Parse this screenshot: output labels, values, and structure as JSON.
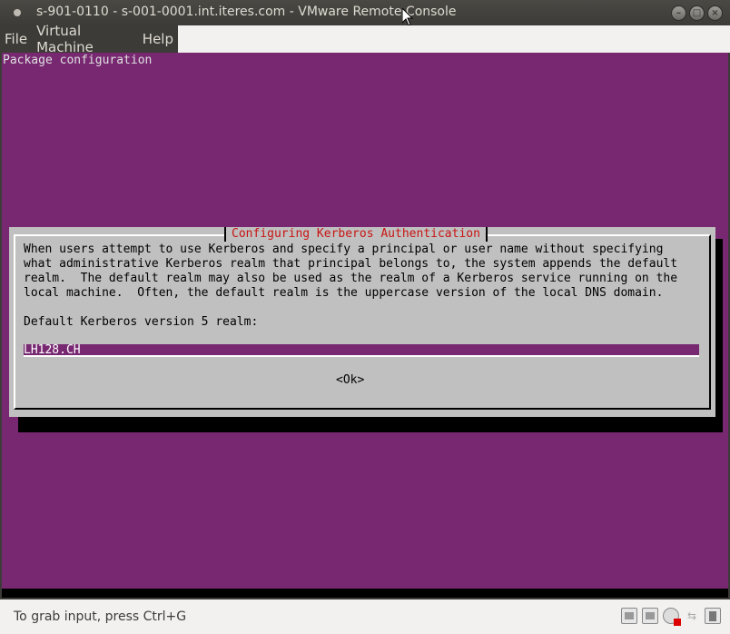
{
  "window": {
    "title": "s-901-0110 - s-001-0001.int.iteres.com - VMware Remote Console",
    "controls": {
      "minimize": "–",
      "maximize": "□",
      "close": "×"
    }
  },
  "menu": {
    "items": [
      "File",
      "Virtual Machine",
      "Help"
    ]
  },
  "console": {
    "header": "Package configuration",
    "colors": {
      "background": "#772871",
      "dialog": "#c0c0c0",
      "title": "#c81414"
    }
  },
  "dialog": {
    "title": "Configuring Kerberos Authentication",
    "body_lines": [
      "When users attempt to use Kerberos and specify a principal or user name without specifying",
      "what administrative Kerberos realm that principal belongs to, the system appends the default",
      "realm.  The default realm may also be used as the realm of a Kerberos service running on the",
      "local machine.  Often, the default realm is the uppercase version of the local DNS domain."
    ],
    "realm_label": "Default Kerberos version 5 realm:",
    "realm_value": "LH128.CH",
    "ok_label": "<Ok>"
  },
  "statusbar": {
    "hint": "To grab input, press Ctrl+G",
    "icons": [
      "hard-disk-icon",
      "hard-disk-icon",
      "cdrom-icon",
      "network-icon",
      "usb-icon"
    ]
  }
}
